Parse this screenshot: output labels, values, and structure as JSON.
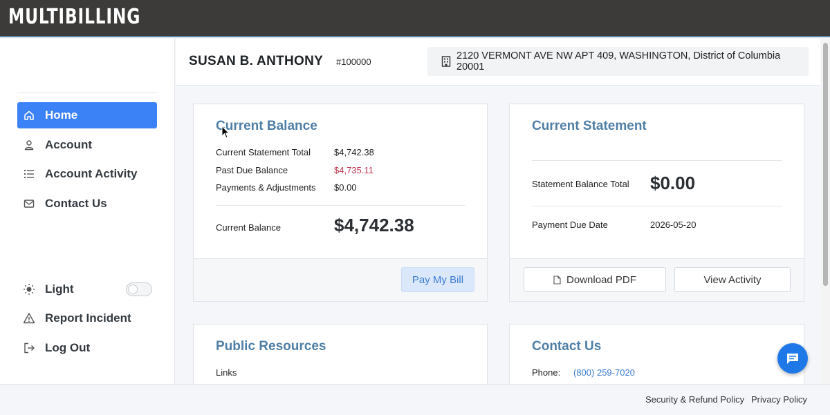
{
  "app": {
    "brand": "MULTIBILLING"
  },
  "sidebar": {
    "items": [
      {
        "label": "Home",
        "icon": "home-icon",
        "active": true
      },
      {
        "label": "Account",
        "icon": "user-icon"
      },
      {
        "label": "Account Activity",
        "icon": "list-icon"
      },
      {
        "label": "Contact Us",
        "icon": "mail-icon"
      }
    ],
    "bottom": [
      {
        "label": "Light",
        "icon": "sun-icon"
      },
      {
        "label": "Report Incident",
        "icon": "warning-icon"
      },
      {
        "label": "Log Out",
        "icon": "logout-icon"
      }
    ],
    "theme_toggle_on": false
  },
  "header": {
    "customer_name": "SUSAN B. ANTHONY",
    "customer_id": "#100000",
    "address": "2120 VERMONT AVE NW APT 409, WASHINGTON, District of Columbia 20001"
  },
  "balance_card": {
    "title": "Current Balance",
    "rows": [
      {
        "label": "Current Statement Total",
        "value": "$4,742.38"
      },
      {
        "label": "Past Due Balance",
        "value": "$4,735.11"
      },
      {
        "label": "Payments & Adjustments",
        "value": "$0.00"
      }
    ],
    "total_label": "Current Balance",
    "total_value": "$4,742.38",
    "pay_button": "Pay My Bill"
  },
  "statement_card": {
    "title": "Current Statement",
    "balance_label": "Statement Balance Total",
    "balance_value": "$0.00",
    "due_label": "Payment Due Date",
    "due_value": "2026-05-20",
    "download_button": "Download PDF",
    "activity_button": "View Activity"
  },
  "resources_card": {
    "title": "Public Resources",
    "links_label": "Links"
  },
  "contact_card": {
    "title": "Contact Us",
    "phone_label": "Phone:",
    "phone_value": "(800) 259-7020"
  },
  "footer": {
    "security_link": "Security & Refund Policy",
    "privacy_link": "Privacy Policy"
  },
  "colors": {
    "accent": "#3b82f6",
    "title": "#4f7ea6",
    "past_due": "#c2334d",
    "topbar": "#3d3b39"
  }
}
